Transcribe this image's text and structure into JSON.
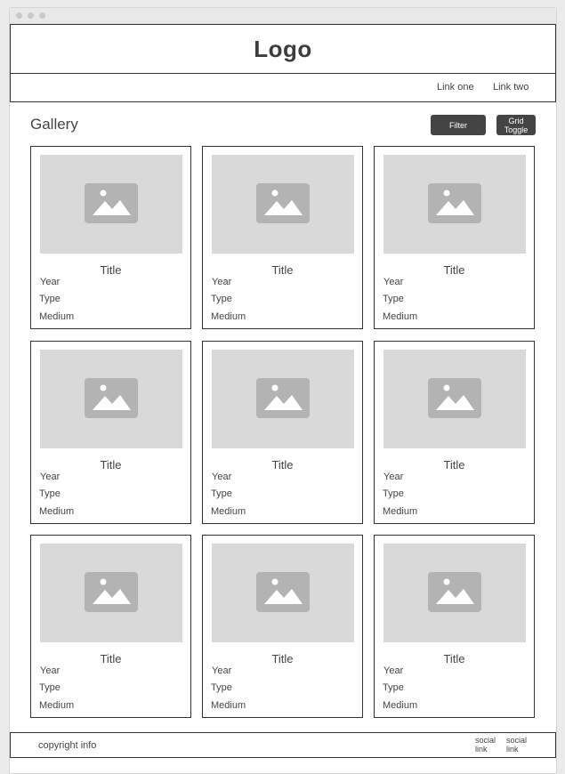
{
  "header": {
    "logo": "Logo"
  },
  "nav": {
    "links": [
      "Link one",
      "Link two"
    ]
  },
  "gallery": {
    "title": "Gallery",
    "filter_label": "Filter",
    "grid_toggle_label": "Grid Toggle",
    "cards": [
      {
        "title": "Title",
        "year": "Year",
        "type": "Type",
        "medium": "Medium"
      },
      {
        "title": "Title",
        "year": "Year",
        "type": "Type",
        "medium": "Medium"
      },
      {
        "title": "Title",
        "year": "Year",
        "type": "Type",
        "medium": "Medium"
      },
      {
        "title": "Title",
        "year": "Year",
        "type": "Type",
        "medium": "Medium"
      },
      {
        "title": "Title",
        "year": "Year",
        "type": "Type",
        "medium": "Medium"
      },
      {
        "title": "Title",
        "year": "Year",
        "type": "Type",
        "medium": "Medium"
      },
      {
        "title": "Title",
        "year": "Year",
        "type": "Type",
        "medium": "Medium"
      },
      {
        "title": "Title",
        "year": "Year",
        "type": "Type",
        "medium": "Medium"
      },
      {
        "title": "Title",
        "year": "Year",
        "type": "Type",
        "medium": "Medium"
      }
    ]
  },
  "footer": {
    "copyright": "copyright info",
    "social_links": [
      "social link",
      "social link"
    ]
  },
  "icons": {
    "thumbnail": "image-placeholder-icon"
  },
  "colors": {
    "button_bg": "#444444",
    "thumb_bg": "#d9d9d9",
    "icon_bg": "#b3b3b3",
    "border": "#333333"
  }
}
